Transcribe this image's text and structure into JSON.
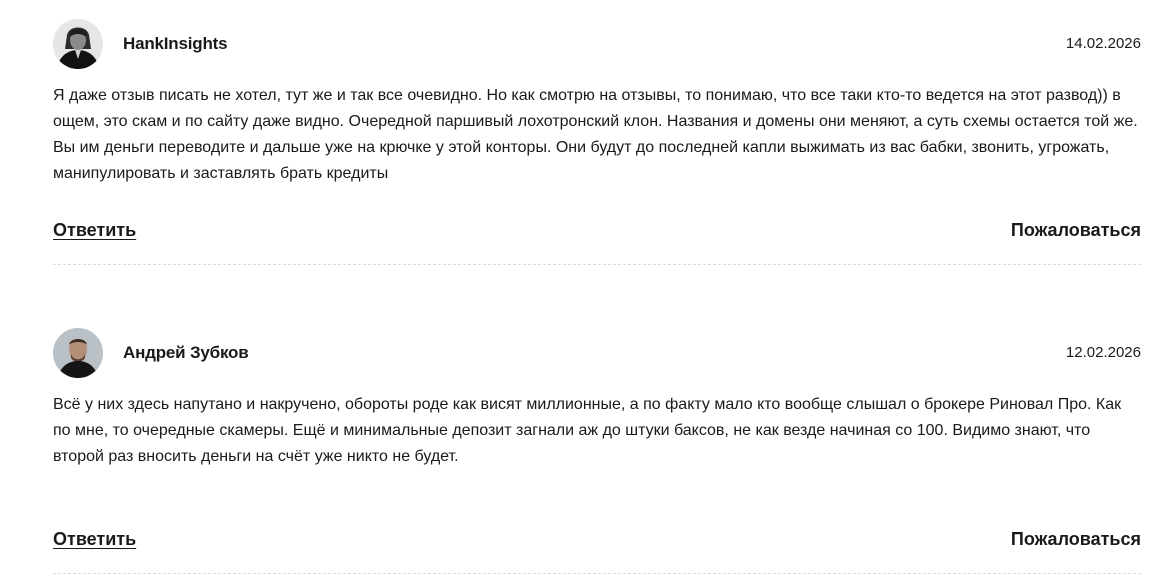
{
  "comments": [
    {
      "author": "HankInsights",
      "date": "14.02.2026",
      "text": "Я даже отзыв писать не хотел, тут же и так все очевидно. Но как смотрю на отзывы, то понимаю, что все таки кто-то ведется на этот развод)) в ощем, это скам и по сайту даже видно. Очередной паршивый лохотронский клон. Названия и домены они меняют, а суть схемы остается той же. Вы им деньги переводите и дальше уже на крючке у этой конторы. Они будут до последней капли выжимать из вас бабки, звонить, угрожать, манипулировать и заставлять брать кредиты",
      "reply_label": "Ответить",
      "report_label": "Пожаловаться",
      "avatar_icon": "user-photo-icon"
    },
    {
      "author": "Андрей Зубков",
      "date": "12.02.2026",
      "text": "Всё у них здесь напутано и накручено, обороты роде как висят миллионные, а по факту мало кто вообще слышал о брокере Риновал Про. Как по мне, то очередные скамеры. Ещё и минимальные депозит загнали аж до штуки баксов, не как везде начиная со 100. Видимо знают, что второй раз вносить деньги на счёт уже никто не будет.",
      "reply_label": "Ответить",
      "report_label": "Пожаловаться",
      "avatar_icon": "user-photo-icon"
    }
  ],
  "colors": {
    "text": "#1a1a1a",
    "divider": "#dcdcdc",
    "background": "#ffffff"
  }
}
